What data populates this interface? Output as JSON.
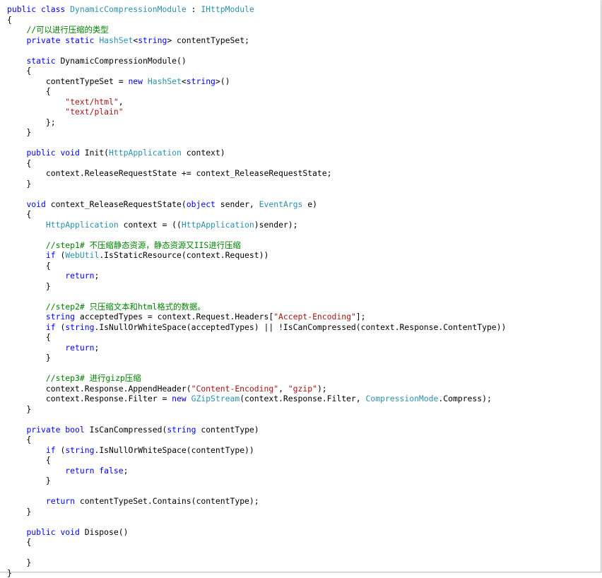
{
  "document": {
    "language": "C#",
    "colors": {
      "keyword": "#0000ff",
      "type": "#2b91af",
      "string": "#a31515",
      "comment": "#008000",
      "plain": "#000000"
    },
    "lines": [
      [
        [
          "kw",
          "public class "
        ],
        [
          "ty",
          "DynamicCompressionModule"
        ],
        [
          "p",
          " : "
        ],
        [
          "ty",
          "IHttpModule"
        ]
      ],
      [
        [
          "p",
          "{"
        ]
      ],
      [
        [
          "p",
          "    "
        ],
        [
          "cm",
          "//可以进行压缩的类型"
        ]
      ],
      [
        [
          "p",
          "    "
        ],
        [
          "kw",
          "private static "
        ],
        [
          "ty",
          "HashSet"
        ],
        [
          "p",
          "<"
        ],
        [
          "kw",
          "string"
        ],
        [
          "p",
          "> contentTypeSet;"
        ]
      ],
      [],
      [
        [
          "p",
          "    "
        ],
        [
          "kw",
          "static "
        ],
        [
          "p",
          "DynamicCompressionModule()"
        ]
      ],
      [
        [
          "p",
          "    {"
        ]
      ],
      [
        [
          "p",
          "        contentTypeSet = "
        ],
        [
          "kw",
          "new "
        ],
        [
          "ty",
          "HashSet"
        ],
        [
          "p",
          "<"
        ],
        [
          "kw",
          "string"
        ],
        [
          "p",
          ">()"
        ]
      ],
      [
        [
          "p",
          "        {"
        ]
      ],
      [
        [
          "p",
          "            "
        ],
        [
          "str",
          "\"text/html\""
        ],
        [
          "p",
          ","
        ]
      ],
      [
        [
          "p",
          "            "
        ],
        [
          "str",
          "\"text/plain\""
        ]
      ],
      [
        [
          "p",
          "        };"
        ]
      ],
      [
        [
          "p",
          "    }"
        ]
      ],
      [],
      [
        [
          "p",
          "    "
        ],
        [
          "kw",
          "public void "
        ],
        [
          "p",
          "Init("
        ],
        [
          "ty",
          "HttpApplication"
        ],
        [
          "p",
          " context)"
        ]
      ],
      [
        [
          "p",
          "    {"
        ]
      ],
      [
        [
          "p",
          "        context.ReleaseRequestState += context_ReleaseRequestState;"
        ]
      ],
      [
        [
          "p",
          "    }"
        ]
      ],
      [],
      [
        [
          "p",
          "    "
        ],
        [
          "kw",
          "void "
        ],
        [
          "p",
          "context_ReleaseRequestState("
        ],
        [
          "kw",
          "object "
        ],
        [
          "p",
          "sender, "
        ],
        [
          "ty",
          "EventArgs"
        ],
        [
          "p",
          " e)"
        ]
      ],
      [
        [
          "p",
          "    {"
        ]
      ],
      [
        [
          "p",
          "        "
        ],
        [
          "ty",
          "HttpApplication"
        ],
        [
          "p",
          " context = (("
        ],
        [
          "ty",
          "HttpApplication"
        ],
        [
          "p",
          ")sender);"
        ]
      ],
      [],
      [
        [
          "p",
          "        "
        ],
        [
          "cm",
          "//step1# 不压缩静态资源，静态资源又IIS进行压缩"
        ]
      ],
      [
        [
          "p",
          "        "
        ],
        [
          "kw",
          "if "
        ],
        [
          "p",
          "("
        ],
        [
          "ty",
          "WebUtil"
        ],
        [
          "p",
          ".IsStaticResource(context.Request))"
        ]
      ],
      [
        [
          "p",
          "        {"
        ]
      ],
      [
        [
          "p",
          "            "
        ],
        [
          "kw",
          "return"
        ],
        [
          "p",
          ";"
        ]
      ],
      [
        [
          "p",
          "        }"
        ]
      ],
      [],
      [
        [
          "p",
          "        "
        ],
        [
          "cm",
          "//step2# 只压缩文本和html格式的数据。"
        ]
      ],
      [
        [
          "p",
          "        "
        ],
        [
          "kw",
          "string "
        ],
        [
          "p",
          "acceptedTypes = context.Request.Headers["
        ],
        [
          "str",
          "\"Accept-Encoding\""
        ],
        [
          "p",
          "];"
        ]
      ],
      [
        [
          "p",
          "        "
        ],
        [
          "kw",
          "if "
        ],
        [
          "p",
          "("
        ],
        [
          "kw",
          "string"
        ],
        [
          "p",
          ".IsNullOrWhiteSpace(acceptedTypes) || !IsCanCompressed(context.Response.ContentType))"
        ]
      ],
      [
        [
          "p",
          "        {"
        ]
      ],
      [
        [
          "p",
          "            "
        ],
        [
          "kw",
          "return"
        ],
        [
          "p",
          ";"
        ]
      ],
      [
        [
          "p",
          "        }"
        ]
      ],
      [],
      [
        [
          "p",
          "        "
        ],
        [
          "cm",
          "//step3# 进行gizp压缩"
        ]
      ],
      [
        [
          "p",
          "        context.Response.AppendHeader("
        ],
        [
          "str",
          "\"Content-Encoding\""
        ],
        [
          "p",
          ", "
        ],
        [
          "str",
          "\"gzip\""
        ],
        [
          "p",
          ");"
        ]
      ],
      [
        [
          "p",
          "        context.Response.Filter = "
        ],
        [
          "kw",
          "new "
        ],
        [
          "ty",
          "GZipStream"
        ],
        [
          "p",
          "(context.Response.Filter, "
        ],
        [
          "ty",
          "CompressionMode"
        ],
        [
          "p",
          ".Compress);"
        ]
      ],
      [
        [
          "p",
          "    }"
        ]
      ],
      [],
      [
        [
          "p",
          "    "
        ],
        [
          "kw",
          "private bool "
        ],
        [
          "p",
          "IsCanCompressed("
        ],
        [
          "kw",
          "string "
        ],
        [
          "p",
          "contentType)"
        ]
      ],
      [
        [
          "p",
          "    {"
        ]
      ],
      [
        [
          "p",
          "        "
        ],
        [
          "kw",
          "if "
        ],
        [
          "p",
          "("
        ],
        [
          "kw",
          "string"
        ],
        [
          "p",
          ".IsNullOrWhiteSpace(contentType))"
        ]
      ],
      [
        [
          "p",
          "        {"
        ]
      ],
      [
        [
          "p",
          "            "
        ],
        [
          "kw",
          "return false"
        ],
        [
          "p",
          ";"
        ]
      ],
      [
        [
          "p",
          "        }"
        ]
      ],
      [],
      [
        [
          "p",
          "        "
        ],
        [
          "kw",
          "return "
        ],
        [
          "p",
          "contentTypeSet.Contains(contentType);"
        ]
      ],
      [
        [
          "p",
          "    }"
        ]
      ],
      [],
      [
        [
          "p",
          "    "
        ],
        [
          "kw",
          "public void "
        ],
        [
          "p",
          "Dispose()"
        ]
      ],
      [
        [
          "p",
          "    {"
        ]
      ],
      [],
      [
        [
          "p",
          "    }"
        ]
      ],
      [
        [
          "p",
          "}"
        ]
      ]
    ]
  }
}
